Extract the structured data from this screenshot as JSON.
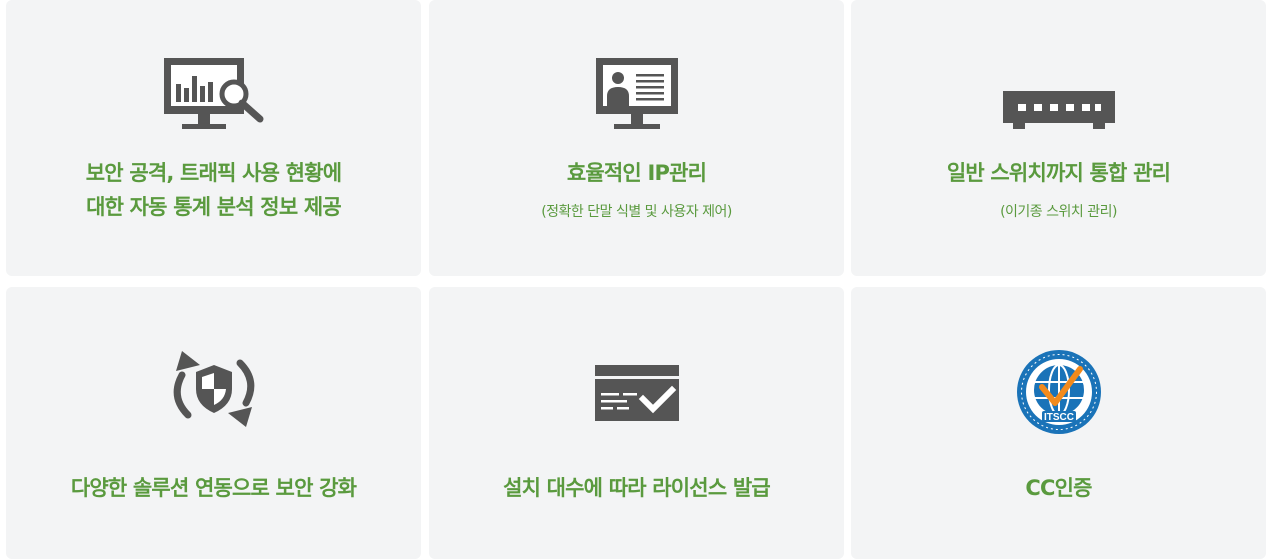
{
  "features": [
    {
      "title_line1": "보안 공격, 트래픽 사용 현황에",
      "title_line2": "대한 자동 통계 분석 정보 제공",
      "icon": "monitor-chart-search-icon"
    },
    {
      "title_line1": "효율적인 IP관리",
      "subtitle": "(정확한 단말 식별 및 사용자 제어)",
      "icon": "monitor-user-id-icon"
    },
    {
      "title_line1": "일반 스위치까지 통합 관리",
      "subtitle": "(이기종 스위치 관리)",
      "icon": "network-switch-icon"
    },
    {
      "title_line1": "다양한 솔루션 연동으로 보안 강화",
      "icon": "shield-sync-icon"
    },
    {
      "title_line1": "설치 대수에 따라 라이선스 발급",
      "icon": "license-check-icon"
    },
    {
      "title_line1": "CC인증",
      "icon": "cc-certification-seal-icon"
    }
  ],
  "colors": {
    "accent": "#5a9a3e",
    "icon": "#555555",
    "card_bg": "#f3f4f5"
  }
}
